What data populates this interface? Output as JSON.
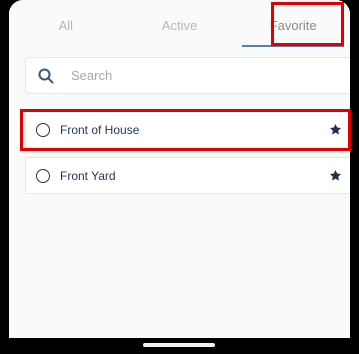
{
  "tabs": [
    {
      "label": "All"
    },
    {
      "label": "Active"
    },
    {
      "label": "Favorite"
    }
  ],
  "search": {
    "placeholder": "Search"
  },
  "items": [
    {
      "label": "Front of House",
      "favorite": true
    },
    {
      "label": "Front Yard",
      "favorite": true
    }
  ],
  "colors": {
    "accent": "#5b7fa8",
    "text_primary": "#243a55",
    "highlight": "#e10000"
  }
}
